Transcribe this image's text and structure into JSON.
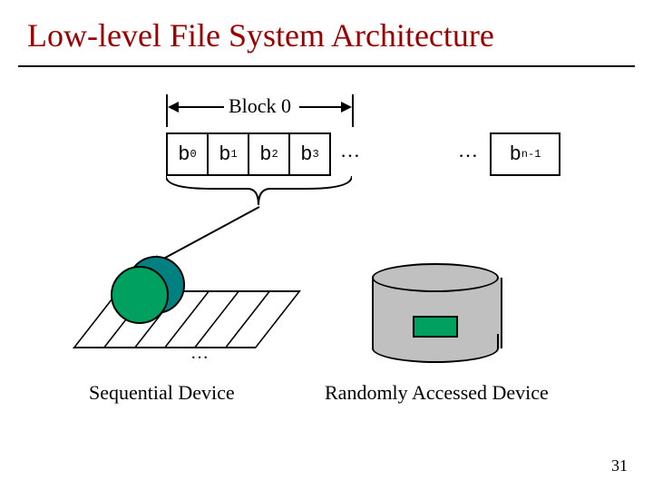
{
  "title": "Low-level File System Architecture",
  "slide_number": "31",
  "block_label": "Block 0",
  "cells": {
    "b0": "b",
    "s0": "0",
    "b1": "b",
    "s1": "1",
    "b2": "b",
    "s2": "2",
    "b3": "b",
    "s3": "3"
  },
  "dots1": "…",
  "dots2": "…",
  "bn": "b",
  "bn_sub": "n-1",
  "tape_dots": "…",
  "sequential_label": "Sequential Device",
  "random_label": "Randomly Accessed Device"
}
